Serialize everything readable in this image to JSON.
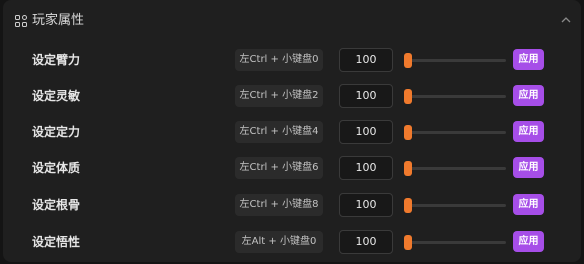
{
  "panel": {
    "title": "玩家属性",
    "header_icon": "attributes-icon",
    "collapse_icon": "chevron-up-icon"
  },
  "colors": {
    "accent_orange": "#f07a2d",
    "apply_purple": "#a64ee8"
  },
  "rows": [
    {
      "label": "设定臂力",
      "hotkey": "左Ctrl + 小键盘0",
      "value": "100",
      "slider_fraction": 0.0,
      "apply_label": "应用"
    },
    {
      "label": "设定灵敏",
      "hotkey": "左Ctrl + 小键盘2",
      "value": "100",
      "slider_fraction": 0.0,
      "apply_label": "应用"
    },
    {
      "label": "设定定力",
      "hotkey": "左Ctrl + 小键盘4",
      "value": "100",
      "slider_fraction": 0.0,
      "apply_label": "应用"
    },
    {
      "label": "设定体质",
      "hotkey": "左Ctrl + 小键盘6",
      "value": "100",
      "slider_fraction": 0.0,
      "apply_label": "应用"
    },
    {
      "label": "设定根骨",
      "hotkey": "左Ctrl + 小键盘8",
      "value": "100",
      "slider_fraction": 0.0,
      "apply_label": "应用"
    },
    {
      "label": "设定悟性",
      "hotkey": "左Alt + 小键盘0",
      "value": "100",
      "slider_fraction": 0.0,
      "apply_label": "应用"
    }
  ]
}
